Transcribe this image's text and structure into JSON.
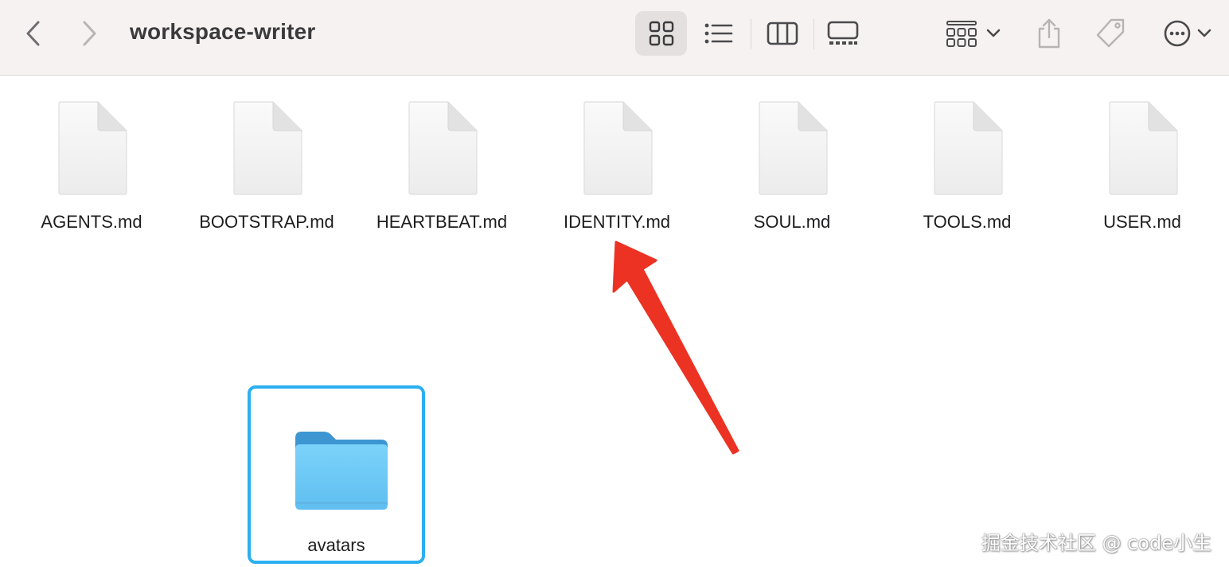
{
  "window": {
    "title": "workspace-writer"
  },
  "toolbar": {
    "icons": {
      "back": "chevron-left-icon",
      "forward": "chevron-right-icon",
      "view_icons": "grid-view-icon",
      "view_list": "list-view-icon",
      "view_columns": "column-view-icon",
      "view_gallery": "gallery-view-icon",
      "group": "group-by-icon",
      "share": "share-icon",
      "tag": "tag-icon",
      "more": "ellipsis-circle-icon"
    },
    "active_view": "icons"
  },
  "files": [
    {
      "name": "AGENTS.md"
    },
    {
      "name": "BOOTSTRAP.md"
    },
    {
      "name": "HEARTBEAT.md"
    },
    {
      "name": "IDENTITY.md"
    },
    {
      "name": "SOUL.md"
    },
    {
      "name": "TOOLS.md"
    },
    {
      "name": "USER.md"
    }
  ],
  "folders": [
    {
      "name": "avatars",
      "selected": true
    }
  ],
  "annotation": {
    "type": "arrow",
    "color": "#ec3223",
    "points_to": "IDENTITY.md"
  },
  "watermark": {
    "text": "掘金技术社区 @ code小生"
  },
  "colors": {
    "toolbar_bg": "#f6f2f2",
    "selection_border": "#2ab0ef",
    "folder_blue": "#6fcaf6"
  }
}
